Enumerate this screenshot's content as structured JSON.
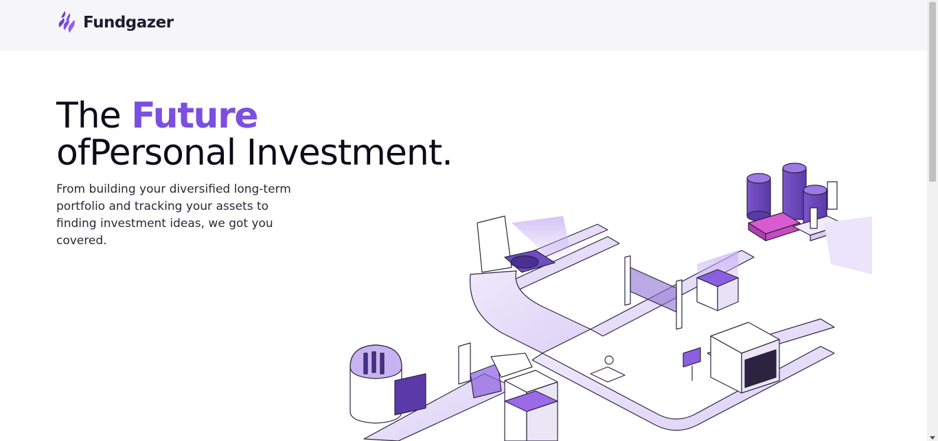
{
  "brand": {
    "name": "Fundgazer",
    "accent_color": "#7b4fe0"
  },
  "hero": {
    "title_prefix": "The ",
    "title_accent": "Future",
    "title_line2": "ofPersonal Investment.",
    "subtitle": "From building your diversified long-term portfolio and tracking your assets to finding investment ideas, we got you covered."
  },
  "illustration": {
    "icon": "isometric-investment-factory-illustration"
  }
}
